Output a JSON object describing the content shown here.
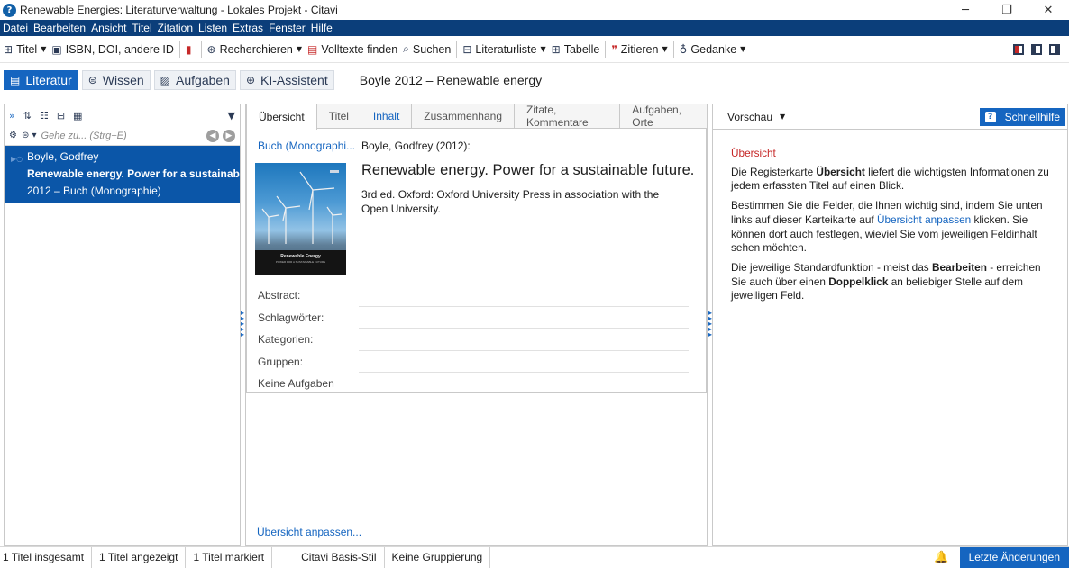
{
  "window": {
    "title": "Renewable Energies: Literaturverwaltung - Lokales Projekt - Citavi",
    "app_icon": "citavi-logo",
    "controls": {
      "minimize": "─",
      "restore": "❐",
      "close": "✕"
    }
  },
  "menubar": {
    "items": [
      "Datei",
      "Bearbeiten",
      "Ansicht",
      "Titel",
      "Zitation",
      "Listen",
      "Extras",
      "Fenster",
      "Hilfe"
    ]
  },
  "toolbar": {
    "titel": "Titel",
    "isbn": "ISBN, DOI, andere ID",
    "recherchieren": "Recherchieren",
    "volltexte": "Volltexte finden",
    "suchen": "Suchen",
    "literaturliste": "Literaturliste",
    "tabelle": "Tabelle",
    "zitieren": "Zitieren",
    "gedanke": "Gedanke"
  },
  "nav": {
    "literatur": "Literatur",
    "wissen": "Wissen",
    "aufgaben": "Aufgaben",
    "ki": "KI-Assistent",
    "current_ref": "Boyle 2012 – Renewable energy"
  },
  "left": {
    "search_placeholder": "Gehe zu... (Strg+E)",
    "item": {
      "author": "Boyle, Godfrey",
      "title": "Renewable energy. Power for a sustainable f",
      "meta": "2012 – Buch (Monographie)"
    }
  },
  "tabs": [
    "Übersicht",
    "Titel",
    "Inhalt",
    "Zusammenhang",
    "Zitate, Kommentare",
    "Aufgaben, Orte"
  ],
  "overview": {
    "type": "Buch (Monographi...",
    "authors": "Boyle, Godfrey (2012):",
    "title": "Renewable energy. Power for a sustainable future.",
    "pubinfo": "3rd ed. Oxford: Oxford University Press in association with the Open University.",
    "cover": {
      "title": "Renewable Energy",
      "subtitle": "POWER FOR A SUSTAINABLE FUTURE"
    },
    "fields": [
      "Abstract:",
      "Schlagwörter:",
      "Kategorien:",
      "Gruppen:",
      "Keine Aufgaben"
    ],
    "adjust": "Übersicht anpassen..."
  },
  "right": {
    "preview": "Vorschau",
    "help": "Schnellhilfe",
    "heading": "Übersicht",
    "p1a": "Die Registerkarte ",
    "p1b": "Übersicht",
    "p1c": " liefert die wichtigsten Informationen zu jedem erfassten Titel auf einen Blick.",
    "p2a": "Bestimmen Sie die Felder, die Ihnen wichtig sind, indem Sie unten links auf dieser Karteikarte auf ",
    "p2b": "Übersicht anpassen",
    "p2c": " klicken. Sie können dort auch festlegen, wieviel Sie vom jeweiligen Feldinhalt sehen möchten.",
    "p3a": "Die jeweilige Standardfunktion - meist das ",
    "p3b": "Bearbeiten",
    "p3c": " - erreichen Sie auch über einen ",
    "p3d": "Doppelklick",
    "p3e": " an beliebiger Stelle auf dem jeweiligen Feld."
  },
  "status": {
    "total": "1 Titel insgesamt",
    "shown": "1 Titel angezeigt",
    "marked": "1 Titel markiert",
    "style": "Citavi Basis-Stil",
    "grouping": "Keine Gruppierung",
    "last_changes": "Letzte Änderungen"
  },
  "colors": {
    "accent": "#1565c0",
    "menubar": "#0b3e7a",
    "selection": "#0b56a8",
    "heading_red": "#c62828"
  }
}
